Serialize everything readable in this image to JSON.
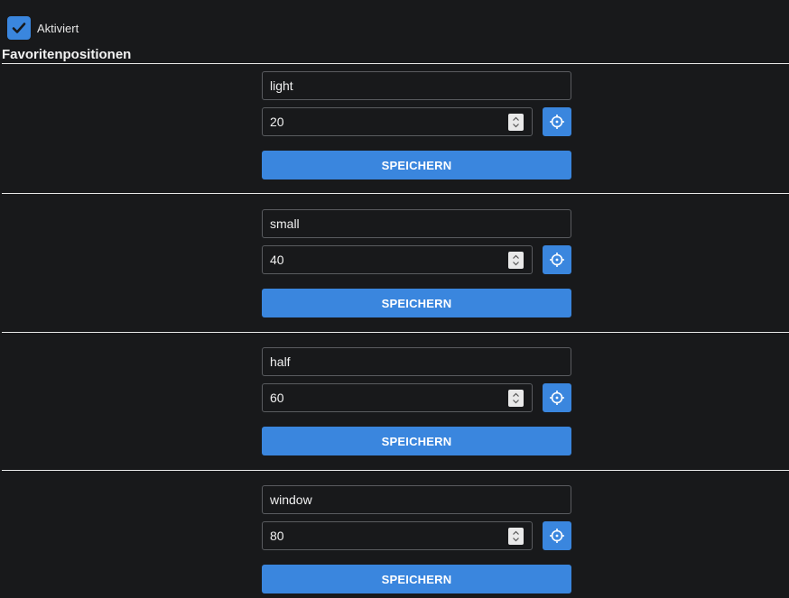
{
  "enabled": {
    "label": "Aktiviert",
    "checked": true,
    "icon": "check-icon"
  },
  "section_title": "Favoritenpositionen",
  "favorites": [
    {
      "name": "light",
      "position": "20",
      "save_label": "SPEICHERN"
    },
    {
      "name": "small",
      "position": "40",
      "save_label": "SPEICHERN"
    },
    {
      "name": "half",
      "position": "60",
      "save_label": "SPEICHERN"
    },
    {
      "name": "window",
      "position": "80",
      "save_label": "SPEICHERN"
    }
  ],
  "icons": {
    "target": "crosshair-icon",
    "spinner": "spinner-icon"
  },
  "colors": {
    "background": "#18191b",
    "accent": "#3a86de",
    "divider": "#e8e8e8",
    "input_border": "#5a5c60"
  }
}
